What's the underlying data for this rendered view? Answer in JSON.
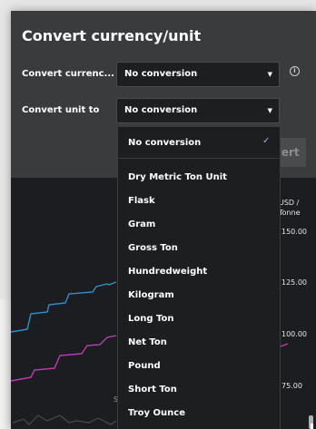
{
  "dialog": {
    "title": "Convert currency/unit",
    "currency_row": {
      "label": "Convert currenc...",
      "value": "No conversion"
    },
    "unit_row": {
      "label": "Convert unit to",
      "value": "No conversion"
    },
    "convert_button_label": "vert"
  },
  "unit_menu": {
    "selected": "No conversion",
    "options": [
      "Dry Metric Ton Unit",
      "Flask",
      "Gram",
      "Gross Ton",
      "Hundredweight",
      "Kilogram",
      "Long Ton",
      "Net Ton",
      "Pound",
      "Short Ton",
      "Troy Ounce"
    ]
  },
  "chart": {
    "axis_title": "USD / Tonne",
    "axis_title_lines": [
      "USD /",
      "Tonne"
    ],
    "y_ticks": [
      "150.00",
      "125.00",
      "100.00",
      "75.00"
    ],
    "partial_label": "S",
    "colors": {
      "blue": "#2f8fd0",
      "magenta": "#c23bb6",
      "gray": "#4a4b4d"
    }
  }
}
